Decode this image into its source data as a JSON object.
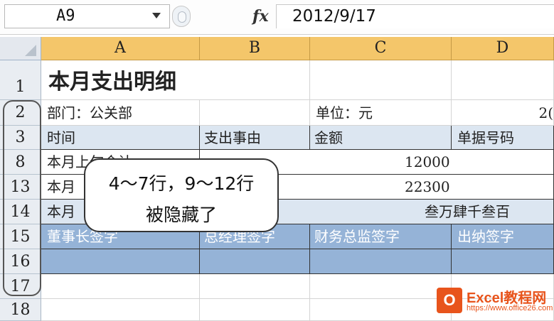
{
  "formula_bar": {
    "cell_ref": "A9",
    "fx_label": "fx",
    "value": "2012/9/17"
  },
  "columns": [
    "A",
    "B",
    "C",
    "D"
  ],
  "rows": [
    "1",
    "2",
    "3",
    "8",
    "13",
    "14",
    "15",
    "16",
    "17",
    "18"
  ],
  "cells": {
    "r1_a": "本月支出明细",
    "r2_a": "部门：公关部",
    "r2_c": "单位：元",
    "r2_d": "2(",
    "r3_a": "时间",
    "r3_b": "支出事由",
    "r3_c": "金额",
    "r3_d": "单据号码",
    "r8_a": "本月上旬合计",
    "r8_c": "12000",
    "r13_a": "本月",
    "r13_c": "22300",
    "r14_a": "本月",
    "r14_c": "叁万肆千叁百",
    "r15_a": "董事长签字",
    "r15_b": "总经理签字",
    "r15_c": "财务总监签字",
    "r15_d": "出纳签字"
  },
  "callout": {
    "line1": "4～7行，9～12行",
    "line2": "被隐藏了"
  },
  "watermark": {
    "logo": "O",
    "brand": "Excel教程网",
    "url": "https://www.office26.com"
  },
  "colors": {
    "header_band": "#dce6f1",
    "sign_row": "#95b3d7",
    "column_header": "#f4c66a"
  }
}
